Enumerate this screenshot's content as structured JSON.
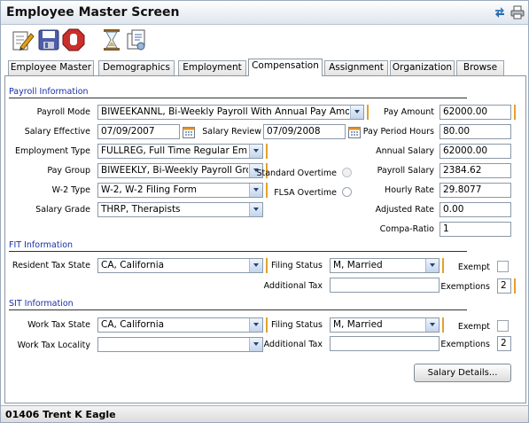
{
  "window": {
    "title": "Employee Master Screen"
  },
  "toolbar": {
    "icons": [
      "edit-icon",
      "save-icon",
      "stop-icon",
      "hourglass-icon",
      "documents-icon"
    ]
  },
  "tabs": [
    {
      "label": "Employee Master"
    },
    {
      "label": "Demographics"
    },
    {
      "label": "Employment"
    },
    {
      "label": "Compensation"
    },
    {
      "label": "Assignment"
    },
    {
      "label": "Organization"
    },
    {
      "label": "Browse"
    }
  ],
  "active_tab": "Compensation",
  "payroll": {
    "section_title": "Payroll Information",
    "payroll_mode_label": "Payroll Mode",
    "payroll_mode_value": "BIWEEKANNL, Bi-Weekly Payroll With Annual Pay Amount",
    "salary_effective_label": "Salary Effective",
    "salary_effective_value": "07/09/2007",
    "salary_review_label": "Salary Review",
    "salary_review_value": "07/09/2008",
    "employment_type_label": "Employment Type",
    "employment_type_value": "FULLREG, Full Time Regular Employee",
    "pay_group_label": "Pay Group",
    "pay_group_value": "BIWEEKLY, Bi-Weekly Payroll Group",
    "w2_type_label": "W-2 Type",
    "w2_type_value": "W-2, W-2 Filing Form",
    "salary_grade_label": "Salary Grade",
    "salary_grade_value": "THRP, Therapists",
    "standard_overtime_label": "Standard Overtime",
    "flsa_overtime_label": "FLSA Overtime",
    "pay_amount_label": "Pay Amount",
    "pay_amount_value": "62000.00",
    "pay_period_hours_label": "Pay Period Hours",
    "pay_period_hours_value": "80.00",
    "annual_salary_label": "Annual Salary",
    "annual_salary_value": "62000.00",
    "payroll_salary_label": "Payroll Salary",
    "payroll_salary_value": "2384.62",
    "hourly_rate_label": "Hourly Rate",
    "hourly_rate_value": "29.8077",
    "adjusted_rate_label": "Adjusted Rate",
    "adjusted_rate_value": "0.00",
    "compa_ratio_label": "Compa-Ratio",
    "compa_ratio_value": "1"
  },
  "fit": {
    "section_title": "FIT Information",
    "resident_tax_state_label": "Resident Tax State",
    "resident_tax_state_value": "CA, California",
    "filing_status_label": "Filing Status",
    "filing_status_value": "M, Married",
    "exempt_label": "Exempt",
    "additional_tax_label": "Additional Tax",
    "additional_tax_value": "",
    "exemptions_label": "Exemptions",
    "exemptions_value": "2"
  },
  "sit": {
    "section_title": "SIT Information",
    "work_tax_state_label": "Work Tax State",
    "work_tax_state_value": "CA, California",
    "work_tax_locality_label": "Work Tax Locality",
    "work_tax_locality_value": "",
    "filing_status_label": "Filing Status",
    "filing_status_value": "M, Married",
    "exempt_label": "Exempt",
    "additional_tax_label": "Additional Tax",
    "additional_tax_value": "",
    "exemptions_label": "Exemptions",
    "exemptions_value": "2"
  },
  "buttons": {
    "salary_details": "Salary Details..."
  },
  "footer": {
    "employee": "01406 Trent K Eagle"
  },
  "colors": {
    "section_title": "#1b2fa8",
    "required_marker": "#e4a12c",
    "dropdown_button": "#c3d4ec"
  }
}
